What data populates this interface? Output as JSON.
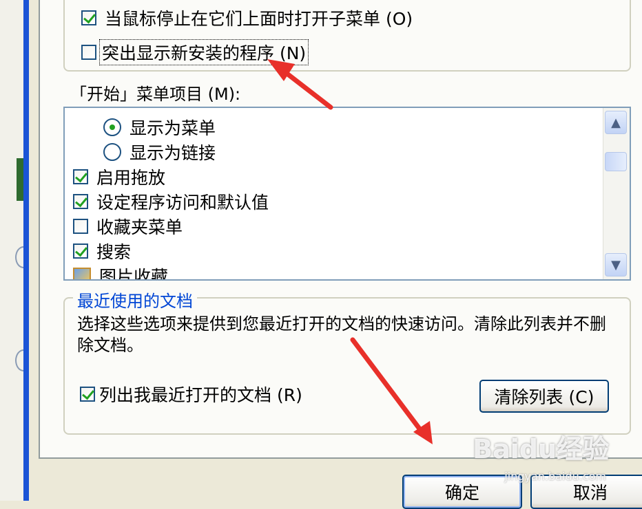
{
  "top_options": [
    {
      "label": "当鼠标停止在它们上面时打开子菜单",
      "accel": "(O)",
      "checked": true
    },
    {
      "label": "突出显示新安装的程序",
      "accel": "(N)",
      "checked": false
    }
  ],
  "start_menu_items_label": "「开始」菜单项目 (M):",
  "list_items": [
    {
      "type": "radio",
      "label": "显示为菜单",
      "selected": true
    },
    {
      "type": "radio",
      "label": "显示为链接",
      "selected": false
    },
    {
      "type": "checkbox",
      "label": "启用拖放",
      "checked": true
    },
    {
      "type": "checkbox",
      "label": "设定程序访问和默认值",
      "checked": true
    },
    {
      "type": "checkbox",
      "label": "收藏夹菜单",
      "checked": false
    },
    {
      "type": "checkbox",
      "label": "搜索",
      "checked": true
    },
    {
      "type": "icon",
      "icon": "picture-icon",
      "label": "图片收藏"
    }
  ],
  "recent_docs": {
    "title": "最近使用的文档",
    "description": "选择这些选项来提供到您最近打开的文档的快速访问。清除此列表并不删除文档。",
    "list_checkbox_label": "列出我最近打开的文档",
    "list_checkbox_accel": "(R)",
    "list_checked": true,
    "clear_button": "清除列表 (C)"
  },
  "buttons": {
    "ok": "确定",
    "cancel": "取消"
  },
  "watermark": {
    "brand": "Baidu经验",
    "url": "jingyan.baidu.com"
  },
  "colors": {
    "accent": "#0046d5",
    "annotation_arrow": "#e8302a",
    "check": "#21a121"
  }
}
